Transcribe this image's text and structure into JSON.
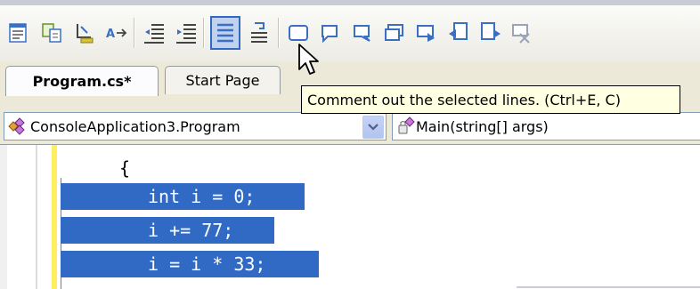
{
  "toolbar": {
    "icons": [
      "view-list-icon",
      "split-view-icon",
      "format-icon",
      "rename-icon",
      "decrease-indent-icon",
      "increase-indent-icon",
      "comment-out-icon",
      "uncomment-icon",
      "bookmark-toggle-icon",
      "bookmark-previous-icon",
      "bookmark-next-icon",
      "bookmark-previous-folder-icon",
      "bookmark-next-folder-icon",
      "bookmark-previous-document-icon",
      "bookmark-next-document-icon",
      "clear-bookmarks-icon"
    ],
    "active_icon": "comment-out-icon",
    "colors": {
      "highlight_fill": "#c1d2ee",
      "highlight_border": "#316ac5",
      "bookmark_blue": "#3a6fc4"
    }
  },
  "tabs": [
    {
      "label": "Program.cs*",
      "active": true
    },
    {
      "label": "Start Page",
      "active": false
    }
  ],
  "tooltip": {
    "text": "Comment out the selected lines. (Ctrl+E, C)"
  },
  "navigation": {
    "class_combo": "ConsoleApplication3.Program",
    "member_combo": "Main(string[] args)"
  },
  "editor": {
    "brace": "{",
    "lines": [
      "int i = 0;",
      "i += 77;",
      "i = i * 33;"
    ],
    "colors": {
      "selection": "#316ac5",
      "change_bar": "#ffee62"
    }
  }
}
